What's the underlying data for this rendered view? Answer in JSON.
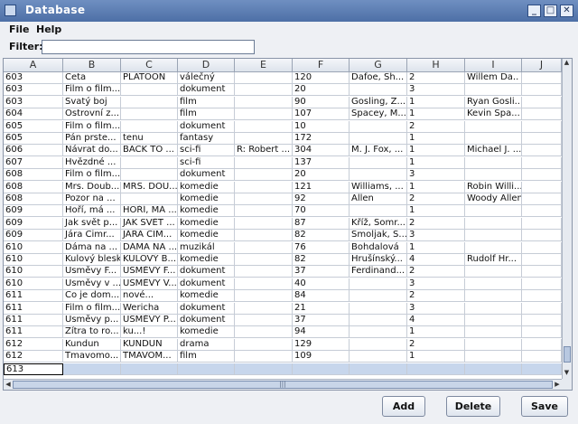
{
  "window": {
    "title": "Database",
    "minimize_glyph": "_",
    "maximize_glyph": "□",
    "close_glyph": "✕"
  },
  "menu": {
    "file": "File",
    "help": "Help"
  },
  "filter": {
    "label": "Filter:",
    "value": ""
  },
  "columns": [
    "A",
    "B",
    "C",
    "D",
    "E",
    "F",
    "G",
    "H",
    "I",
    "J"
  ],
  "rows": [
    [
      "603",
      "Četa",
      "PLATOON",
      "válečný",
      "",
      "120",
      "Dafoe, Sh...",
      "2",
      "Willem Da..",
      ""
    ],
    [
      "603",
      "Film o film...",
      "",
      "dokument",
      "",
      "20",
      "",
      "3",
      "",
      ""
    ],
    [
      "603",
      "Svatý boj",
      "",
      "film",
      "",
      "90",
      "Gosling, Z...",
      "1",
      "Ryan Gosli...",
      ""
    ],
    [
      "604",
      "Ostrovní z...",
      "",
      "film",
      "",
      "107",
      "Spacey, M...",
      "1",
      "Kevin Spa...",
      ""
    ],
    [
      "605",
      "Film o film...",
      "",
      "dokument",
      "",
      "10",
      "",
      "2",
      "",
      ""
    ],
    [
      "605",
      "Pán prste...",
      "tenu",
      "fantasy",
      "",
      "172",
      "",
      "1",
      "",
      ""
    ],
    [
      "606",
      "Návrat do...",
      "BACK TO ...",
      "sci-fi",
      "R: Robert ...",
      "304",
      "M. J. Fox, ...",
      "1",
      "Michael J. ...",
      ""
    ],
    [
      "607",
      "Hvězdné ...",
      "",
      "sci-fi",
      "",
      "137",
      "",
      "1",
      "",
      ""
    ],
    [
      "608",
      "Film o film...",
      "",
      "dokument",
      "",
      "20",
      "",
      "3",
      "",
      ""
    ],
    [
      "608",
      "Mrs. Doub...",
      "MRS. DOU...",
      "komedie",
      "",
      "121",
      "Williams, ...",
      "1",
      "Robin Willi...",
      ""
    ],
    [
      "608",
      "Pozor na ...",
      "",
      "komedie",
      "",
      "92",
      "Allen",
      "2",
      "Woody Allen",
      ""
    ],
    [
      "609",
      "Hoří, má ...",
      "HOŘÍ, MÁ ...",
      "komedie",
      "",
      "70",
      "",
      "1",
      "",
      ""
    ],
    [
      "609",
      "Jak svět p...",
      "JAK SVĚT ...",
      "komedie",
      "",
      "87",
      "Kříž, Somr...",
      "2",
      "",
      ""
    ],
    [
      "609",
      "Jára Cimr...",
      "JÁRA CIM...",
      "komedie",
      "",
      "82",
      "Smoljak, S...",
      "3",
      "",
      ""
    ],
    [
      "610",
      "Dáma na ...",
      "DÁMA NA ...",
      "muzikál",
      "",
      "76",
      "Bohdalová",
      "1",
      "",
      ""
    ],
    [
      "610",
      "Kulový blesk",
      "KULOVÝ B...",
      "komedie",
      "",
      "82",
      "Hrušínský...",
      "4",
      "Rudolf Hr...",
      ""
    ],
    [
      "610",
      "Úsměvy F...",
      "ÚSMĚVY F...",
      "dokument",
      "",
      "37",
      "Ferdinand...",
      "2",
      "",
      ""
    ],
    [
      "610",
      "Úsměvy v ...",
      "ÚSMĚVY V...",
      "dokument",
      "",
      "40",
      "",
      "3",
      "",
      ""
    ],
    [
      "611",
      "Co je dom...",
      "nové...",
      "komedie",
      "",
      "84",
      "",
      "2",
      "",
      ""
    ],
    [
      "611",
      "Film o film...",
      "Wericha",
      "dokument",
      "",
      "21",
      "",
      "3",
      "",
      ""
    ],
    [
      "611",
      "Úsměvy p...",
      "ÚSMĚVY P...",
      "dokument",
      "",
      "37",
      "",
      "4",
      "",
      ""
    ],
    [
      "611",
      "Zítra to ro...",
      "ku...!",
      "komedie",
      "",
      "94",
      "",
      "1",
      "",
      ""
    ],
    [
      "612",
      "Kundun",
      "KUNDUN",
      "drama",
      "",
      "129",
      "",
      "2",
      "",
      ""
    ],
    [
      "612",
      "Tmavomo...",
      "TMAVOM...",
      "film",
      "",
      "109",
      "",
      "1",
      "",
      ""
    ],
    [
      "613",
      "",
      "",
      "",
      "",
      "",
      "",
      "",
      "",
      ""
    ]
  ],
  "buttons": {
    "add": "Add",
    "delete": "Delete",
    "save": "Save"
  },
  "colors": {
    "titlebar": "#5b7cb2",
    "selection": "#c7d6ec"
  }
}
